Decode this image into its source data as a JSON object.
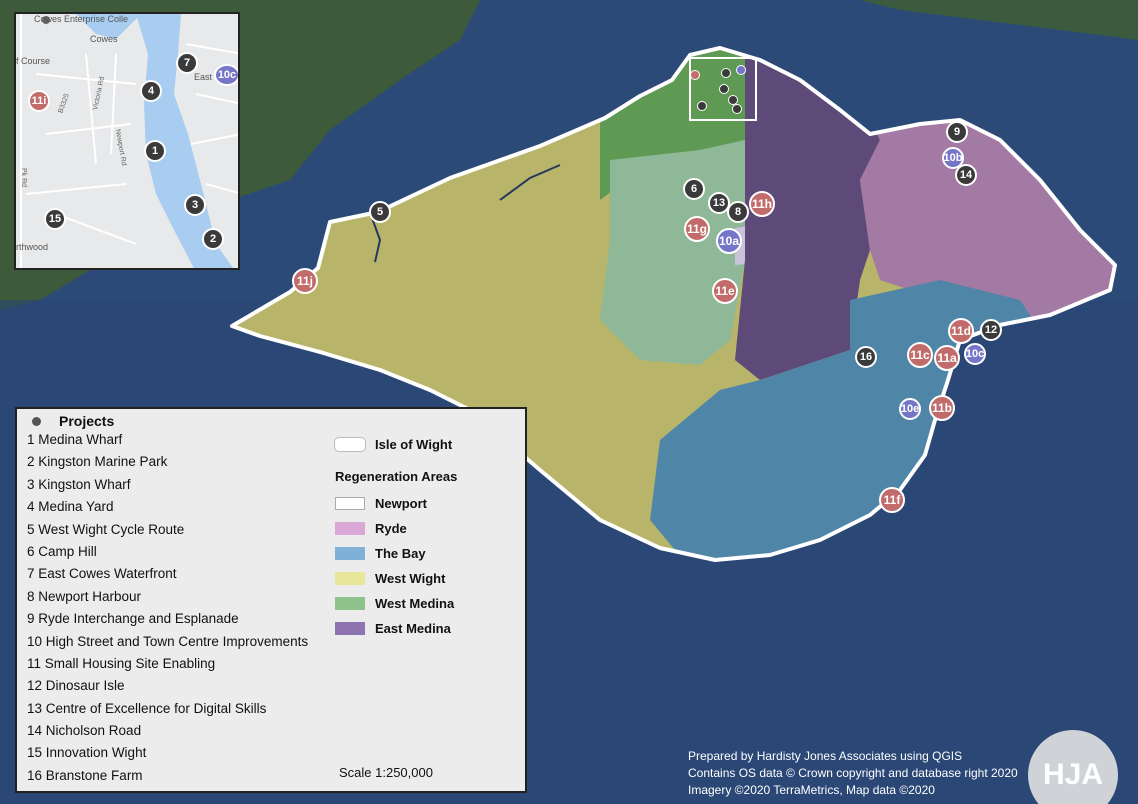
{
  "markers": {
    "m5": "5",
    "m11j": "11j",
    "m6": "6",
    "m13": "13",
    "m8": "8",
    "m11h": "11h",
    "m11g": "11g",
    "m10a": "10a",
    "m11e": "11e",
    "m9": "9",
    "m10b": "10b",
    "m14": "14",
    "m11d": "11d",
    "m12": "12",
    "m16": "16",
    "m11c": "11c",
    "m11a": "11a",
    "m10c": "10c",
    "m10e": "10e",
    "m11b": "11b",
    "m11f": "11f"
  },
  "inset": {
    "place_top": "Cowes Enterprise Colle",
    "place_cowes": "Cowes",
    "place_course": "f Course",
    "place_eastc": "East C",
    "place_northwood": "rthwood",
    "road_b3325": "B3325",
    "road_victoria": "Victoria Rd",
    "road_newport": "Newport Rd",
    "road_pk": "Pk Rd",
    "markers": {
      "m7": "7",
      "m10c": "10c",
      "m4": "4",
      "m11i": "11i",
      "m1": "1",
      "m3": "3",
      "m15": "15",
      "m2": "2"
    }
  },
  "legend": {
    "projects_title": "Projects",
    "projects": [
      "1  Medina Wharf",
      "2  Kingston Marine Park",
      "3  Kingston Wharf",
      "4  Medina Yard",
      "5  West Wight Cycle Route",
      "6  Camp Hill",
      "7  East Cowes Waterfront",
      "8  Newport Harbour",
      "9  Ryde Interchange and Esplanade",
      "10  High Street and Town Centre Improvements",
      "11  Small Housing Site Enabling",
      "12  Dinosaur Isle",
      "13  Centre of Excellence for Digital Skills",
      "14  Nicholson Road",
      "15  Innovation Wight",
      "16  Branstone Farm"
    ],
    "boundary_label": "Isle of Wight",
    "areas_title": "Regeneration Areas",
    "areas": [
      "Newport",
      "Ryde",
      "The Bay",
      "West Wight",
      "West Medina",
      "East Medina"
    ],
    "area_colors": [
      "#ffffff",
      "#d9a8d6",
      "#7fb0d8",
      "#e9e79a",
      "#8ec28a",
      "#8d73b0"
    ],
    "scale": "Scale 1:250,000"
  },
  "credits": [
    "Prepared by Hardisty Jones Associates using QGIS",
    "Contains OS data © Crown copyright and database right 2020",
    "Imagery ©2020 TerraMetrics, Map data ©2020"
  ],
  "logo": "HJA"
}
